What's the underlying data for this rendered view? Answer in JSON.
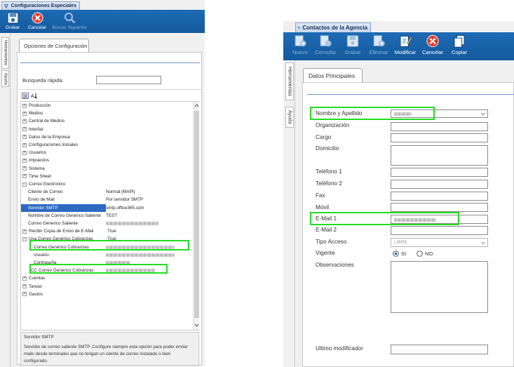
{
  "left": {
    "tab_title": "Configuraciones Especiales",
    "toolbar": [
      {
        "label": "Grabar",
        "icon": "save-icon",
        "enabled": true
      },
      {
        "label": "Cancelar",
        "icon": "cancel-icon",
        "enabled": true
      },
      {
        "label": "Buscar Siguiente",
        "icon": "search-icon",
        "enabled": false
      }
    ],
    "side_tabs": [
      "Herramientas",
      "Ayuda"
    ],
    "section_tab": "Opciones de Configuración",
    "quick_search_label": "Busqueda rápida.",
    "quick_search_value": "",
    "tree": [
      {
        "label": "Producción",
        "value": ""
      },
      {
        "label": "Medios",
        "value": ""
      },
      {
        "label": "Central de Medios",
        "value": ""
      },
      {
        "label": "Interfaz",
        "value": ""
      },
      {
        "label": "Datos de la Empresa",
        "value": ""
      },
      {
        "label": "Configuraciones Iniciales",
        "value": ""
      },
      {
        "label": "Usuarios",
        "value": ""
      },
      {
        "label": "Impuestos",
        "value": ""
      },
      {
        "label": "Sistema",
        "value": ""
      },
      {
        "label": "Time Sheet",
        "value": ""
      },
      {
        "label": "Correo Electrónico",
        "value": ""
      },
      {
        "label": "Cliente de Correo",
        "value": "Normal (MAPI)"
      },
      {
        "label": "Envio de Mail",
        "value": "Por servidor SMTP"
      },
      {
        "label": "Servidor SMTP",
        "value": "smtp.office365.com"
      },
      {
        "label": "Nombre de Correo Generico Saliente",
        "value": "TEST"
      },
      {
        "label": "Correo Generico Saliente",
        "value": ""
      },
      {
        "label": "Recibir Copia de Envio de E-Mail",
        "value": "True"
      },
      {
        "label": "Usa Correo Genérico Cobranzas",
        "value": "True"
      },
      {
        "label": "Correo Genérico Cobranzas",
        "value": ""
      },
      {
        "label": "Usuario",
        "value": ""
      },
      {
        "label": "Contraseña",
        "value": ""
      },
      {
        "label": "CC Correo Genérico Cobranzas",
        "value": ""
      },
      {
        "label": "Cuentas",
        "value": ""
      },
      {
        "label": "Tareas",
        "value": ""
      },
      {
        "label": "Gastos",
        "value": ""
      }
    ],
    "desc_title": "Servidor SMTP",
    "desc_text": "Servidor de correo saliente SMTP. Configure siempre esta opción para poder enviar mails desde terminales que no tengan un cliente de correo instalado o bien configurado."
  },
  "right": {
    "tab_title": "Contactos de la Agencia",
    "toolbar": [
      {
        "label": "Nuevo",
        "icon": "new-icon",
        "enabled": false
      },
      {
        "label": "Consulta",
        "icon": "query-icon",
        "enabled": false
      },
      {
        "label": "Grabar",
        "icon": "save-icon",
        "enabled": false
      },
      {
        "label": "Eliminar",
        "icon": "delete-icon",
        "enabled": false
      },
      {
        "label": "Modificar",
        "icon": "edit-icon",
        "enabled": true
      },
      {
        "label": "Cancelar",
        "icon": "cancel-icon",
        "enabled": true
      },
      {
        "label": "Copiar",
        "icon": "copy-icon",
        "enabled": true
      }
    ],
    "side_tabs": [
      "Herramientas",
      "Ayuda"
    ],
    "section_tab": "Datos Principales",
    "fields": {
      "nombre": "Nombre y Apellido",
      "organizacion": "Organización",
      "cargo": "Cargo",
      "domicilio": "Domicilio",
      "telefono1": "Teléfono 1",
      "telefono2": "Teléfono 2",
      "fax": "Fax",
      "movil": "Móvil",
      "email1": "E-Mail 1",
      "email2": "E-Mail 2",
      "tipo_acceso": "Tipo Acceso",
      "tipo_acceso_value": "LIBRE",
      "vigente": "Vigente",
      "vigente_si": "SI",
      "vigente_no": "NO",
      "observaciones": "Observaciones",
      "ultimo_modificador": "Ultimo modificador"
    },
    "colors": {
      "highlight": "#22dd22",
      "toolbar": "#1d6bb5"
    }
  }
}
